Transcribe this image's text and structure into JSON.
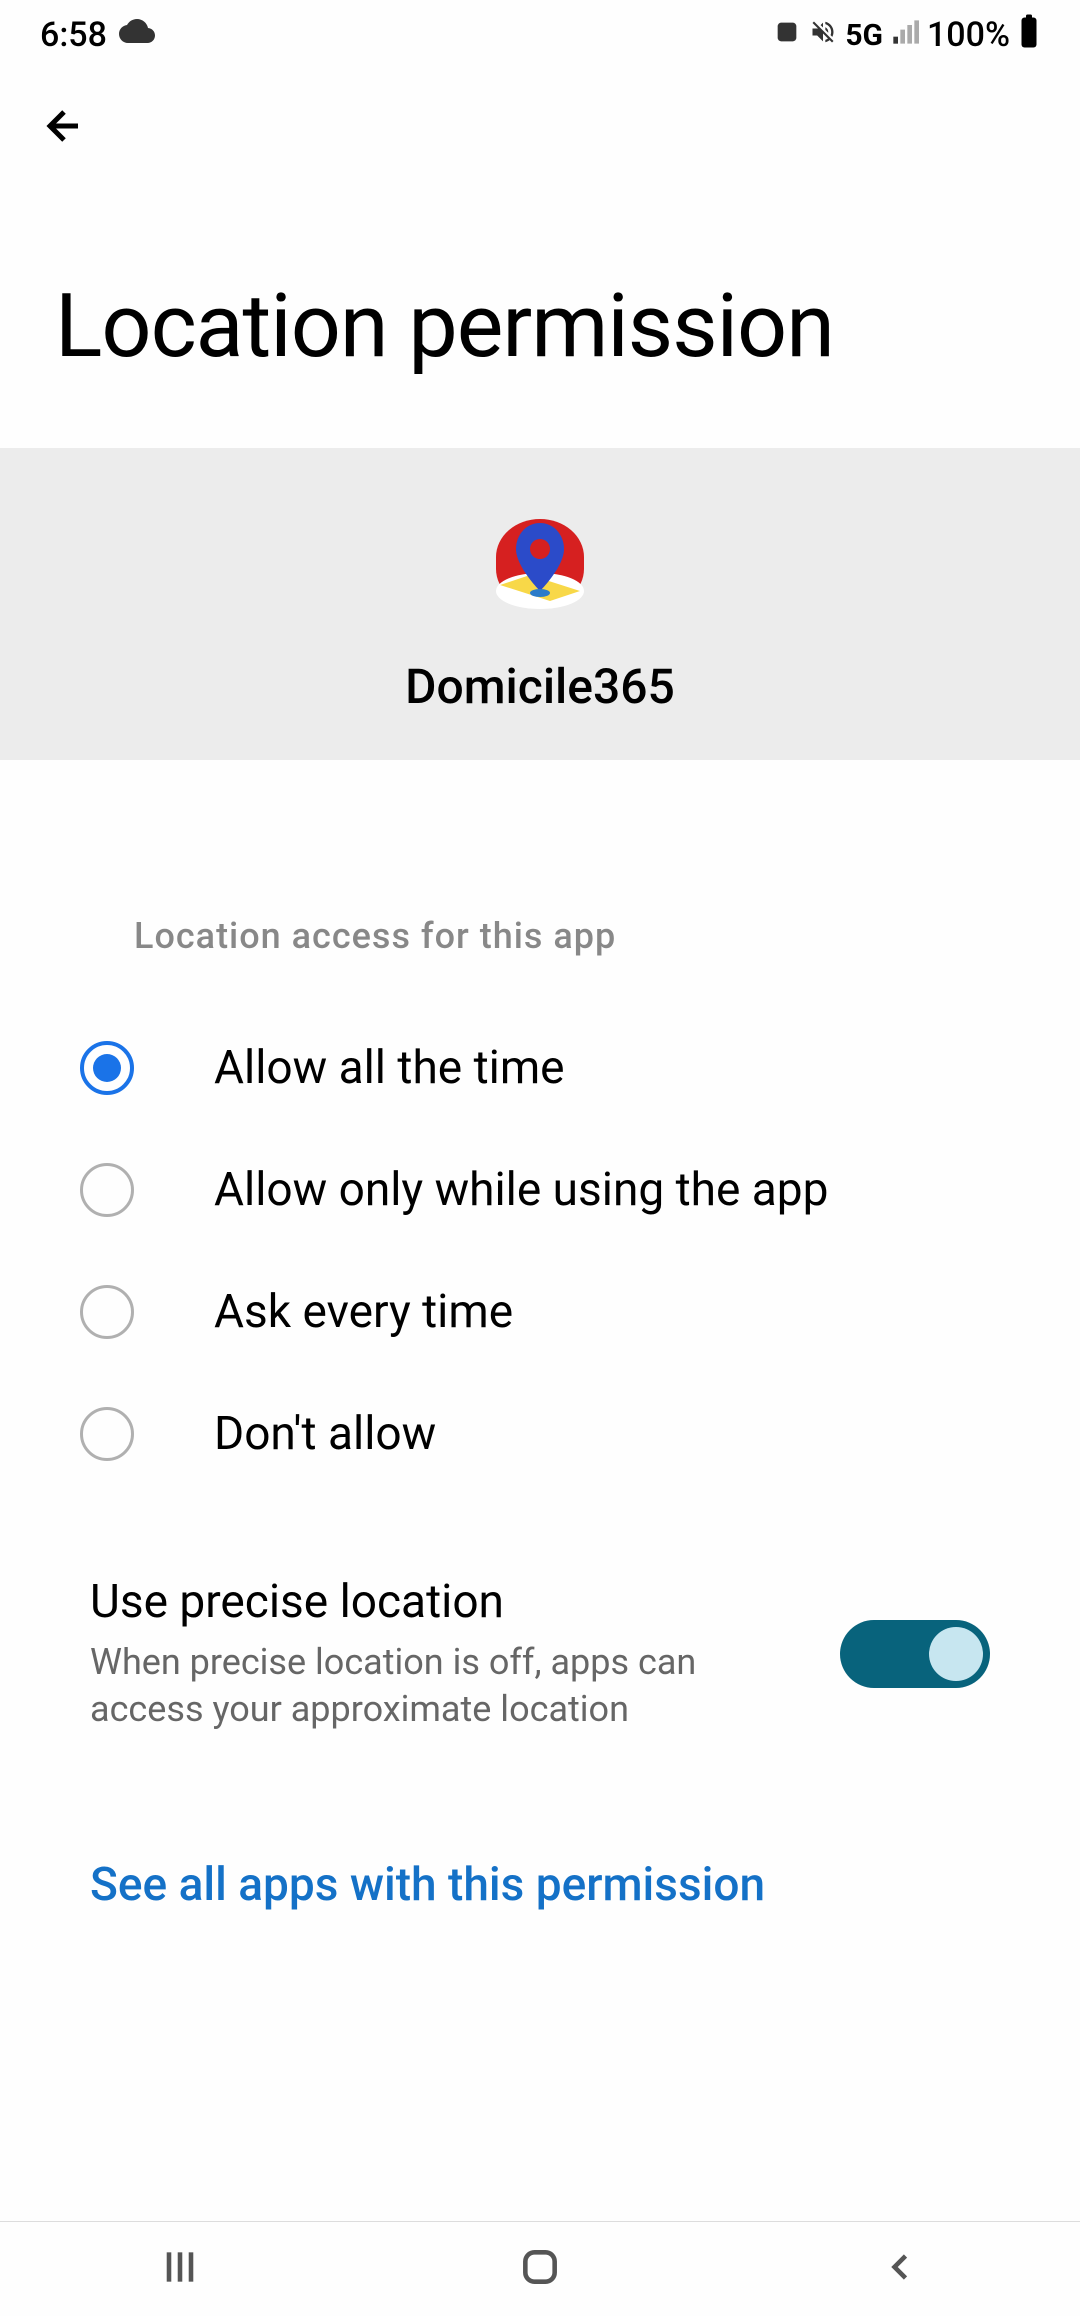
{
  "statusBar": {
    "time": "6:58",
    "network": "5G",
    "battery": "100%"
  },
  "pageTitle": "Location permission",
  "app": {
    "name": "Domicile365"
  },
  "sectionLabel": "Location access for this app",
  "options": {
    "allowAllTime": "Allow all the time",
    "allowWhileUsing": "Allow only while using the app",
    "askEveryTime": "Ask every time",
    "dontAllow": "Don't allow"
  },
  "preciseLocation": {
    "title": "Use precise location",
    "subtitle": "When precise location is off, apps can access your approximate location"
  },
  "link": "See all apps with this permission"
}
